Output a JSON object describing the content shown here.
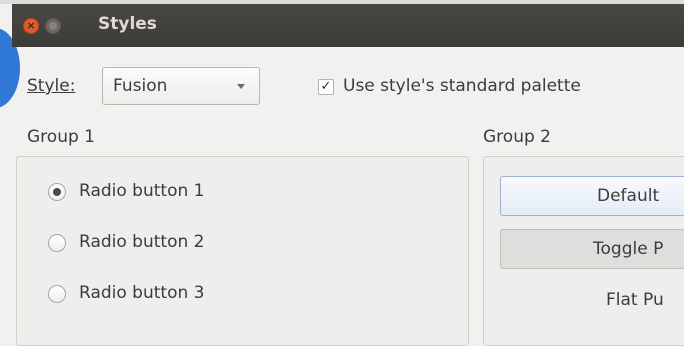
{
  "window": {
    "title": "Styles"
  },
  "style_row": {
    "label": "Style:",
    "selected": "Fusion",
    "palette_checkbox_label": "Use style's standard palette",
    "palette_checked": true
  },
  "group1": {
    "title": "Group 1",
    "radios": [
      {
        "label": "Radio button 1",
        "checked": true
      },
      {
        "label": "Radio button 2",
        "checked": false
      },
      {
        "label": "Radio button 3",
        "checked": false
      }
    ]
  },
  "group2": {
    "title": "Group 2",
    "default_button": "Default",
    "toggle_button": "Toggle P",
    "flat_button": "Flat Pu"
  }
}
